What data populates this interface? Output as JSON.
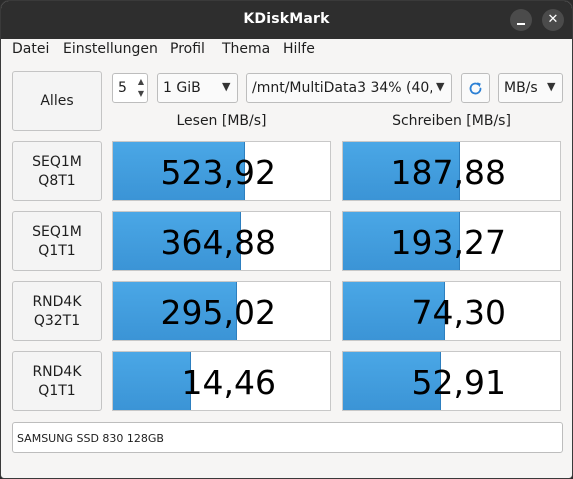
{
  "window": {
    "title": "KDiskMark"
  },
  "menu": [
    "Datei",
    "Einstellungen",
    "Profil",
    "Thema",
    "Hilfe"
  ],
  "toolbar": {
    "all_button": "Alles",
    "runs": "5",
    "size": "1 GiB",
    "path": "/mnt/MultiData3 34% (40,",
    "unit": "MB/s"
  },
  "headers": {
    "read": "Lesen [MB/s]",
    "write": "Schreiben [MB/s]"
  },
  "tests": [
    {
      "line1": "SEQ1M",
      "line2": "Q8T1",
      "read": "523,92",
      "write": "187,88",
      "read_fill": 0.61,
      "write_fill": 0.54
    },
    {
      "line1": "SEQ1M",
      "line2": "Q1T1",
      "read": "364,88",
      "write": "193,27",
      "read_fill": 0.59,
      "write_fill": 0.54
    },
    {
      "line1": "RND4K",
      "line2": "Q32T1",
      "read": "295,02",
      "write": "74,30",
      "read_fill": 0.57,
      "write_fill": 0.47
    },
    {
      "line1": "RND4K",
      "line2": "Q1T1",
      "read": "14,46",
      "write": "52,91",
      "read_fill": 0.36,
      "write_fill": 0.45
    }
  ],
  "device": "SAMSUNG SSD 830 128GB",
  "colors": {
    "bar": "#3b94d6",
    "titlebar": "#2e2e2e",
    "refresh": "#2a7fd4"
  }
}
